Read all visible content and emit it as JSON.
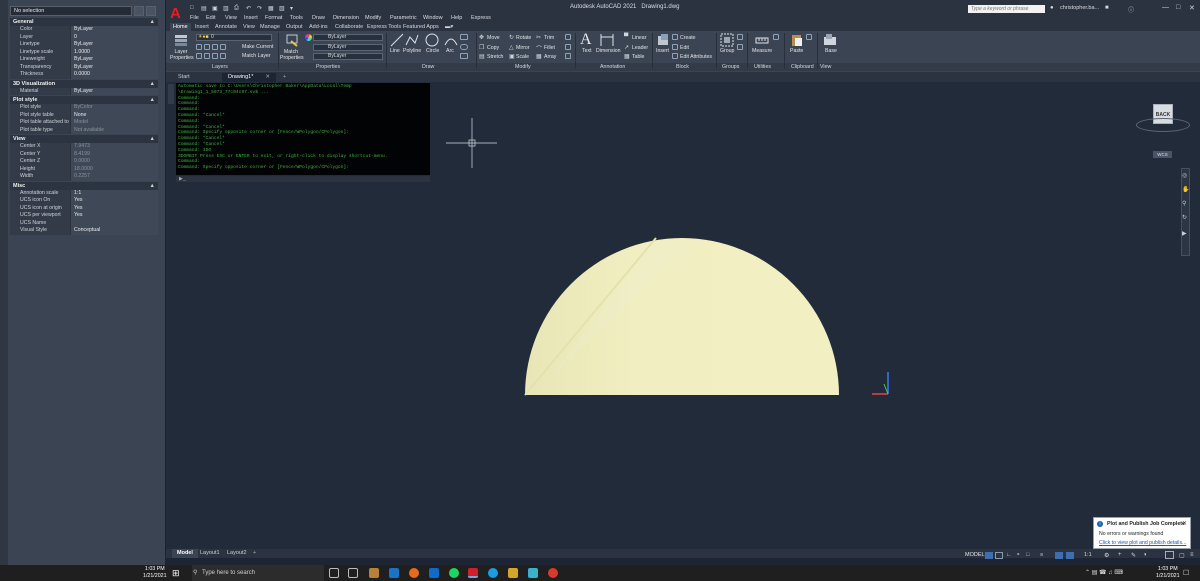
{
  "properties": {
    "selection": "No selection",
    "sections": [
      {
        "title": "General",
        "rows": [
          {
            "k": "Color",
            "v": "ByLayer"
          },
          {
            "k": "Layer",
            "v": "0"
          },
          {
            "k": "Linetype",
            "v": "ByLayer"
          },
          {
            "k": "Linetype scale",
            "v": "1.0000"
          },
          {
            "k": "Lineweight",
            "v": "ByLayer"
          },
          {
            "k": "Transparency",
            "v": "ByLayer"
          },
          {
            "k": "Thickness",
            "v": "0.0000"
          }
        ]
      },
      {
        "title": "3D Visualization",
        "rows": [
          {
            "k": "Material",
            "v": "ByLayer"
          }
        ]
      },
      {
        "title": "Plot style",
        "rows": [
          {
            "k": "Plot style",
            "v": "ByColor",
            "dim": true
          },
          {
            "k": "Plot style table",
            "v": "None"
          },
          {
            "k": "Plot table attached to",
            "v": "Model",
            "dim": true
          },
          {
            "k": "Plot table type",
            "v": "Not available",
            "dim": true
          }
        ]
      },
      {
        "title": "View",
        "rows": [
          {
            "k": "Center X",
            "v": "7.9473",
            "dim": true
          },
          {
            "k": "Center Y",
            "v": "8.4199",
            "dim": true
          },
          {
            "k": "Center Z",
            "v": "0.0000",
            "dim": true
          },
          {
            "k": "Height",
            "v": "18.0000",
            "dim": true
          },
          {
            "k": "Width",
            "v": "0.2257",
            "dim": true
          }
        ]
      },
      {
        "title": "Misc",
        "rows": [
          {
            "k": "Annotation scale",
            "v": "1:1"
          },
          {
            "k": "UCS icon On",
            "v": "Yes"
          },
          {
            "k": "UCS icon at origin",
            "v": "Yes"
          },
          {
            "k": "UCS per viewport",
            "v": "Yes"
          },
          {
            "k": "UCS Name",
            "v": ""
          },
          {
            "k": "Visual Style",
            "v": "Conceptual"
          }
        ]
      }
    ]
  },
  "title": {
    "app": "Autodesk AutoCAD 2021",
    "file": "Drawing1.dwg",
    "search_placeholder": "Type a keyword or phrase",
    "user": "christopher.ba..."
  },
  "menu": [
    "File",
    "Edit",
    "View",
    "Insert",
    "Format",
    "Tools",
    "Draw",
    "Dimension",
    "Modify",
    "Parametric",
    "Window",
    "Help",
    "Express"
  ],
  "ribbon_tabs": [
    "Home",
    "Insert",
    "Annotate",
    "View",
    "Manage",
    "Output",
    "Add-ins",
    "Collaborate",
    "Express Tools",
    "Featured Apps"
  ],
  "ribbon": {
    "layer_properties": "Layer Properties",
    "layer_combo": "0",
    "make_current": "Make Current",
    "match_layer": "Match Layer",
    "match_properties": "Match Properties",
    "bylayer1": "ByLayer",
    "bylayer2": "ByLayer",
    "bylayer3": "ByLayer",
    "line": "Line",
    "polyline": "Polyline",
    "circle": "Circle",
    "arc": "Arc",
    "move": "Move",
    "rotate": "Rotate",
    "trim": "Trim",
    "copy": "Copy",
    "mirror": "Mirror",
    "fillet": "Fillet",
    "stretch": "Stretch",
    "scale": "Scale",
    "array": "Array",
    "text": "Text",
    "dimension": "Dimension",
    "linear": "Linear",
    "leader": "Leader",
    "table": "Table",
    "insert": "Insert",
    "create": "Create",
    "edit": "Edit",
    "edit_attributes": "Edit Attributes",
    "group": "Group",
    "measure": "Measure",
    "paste": "Paste",
    "base": "Base",
    "panels": [
      "Layers",
      "Properties",
      "Draw",
      "Modify",
      "Annotation",
      "Block",
      "Groups",
      "Utilities",
      "Clipboard",
      "View"
    ]
  },
  "file_tabs": [
    "Start",
    "Drawing1*"
  ],
  "command_history": [
    "Automatic save to C:\\Users\\Christopher Baker\\AppData\\Local\\Temp",
    "\\Drawing1_1_5073_77c04c97.sv$ ...",
    "Command:",
    "Command:",
    "Command:",
    "Command: *Cancel*",
    "Command:",
    "Command: *Cancel*",
    "Command: Specify opposite corner or [Fence/WPolygon/CPolygon]:",
    "Command: *Cancel*",
    "Command: *Cancel*",
    "Command: 3DO",
    "3DORBIT Press ESC or ENTER to exit, or right-click to display shortcut-menu.",
    "Command:",
    "Command: Specify opposite corner or [Fence/WPolygon/CPolygon]:"
  ],
  "viewcube": {
    "back": "BACK",
    "wcs": "WCS"
  },
  "layout_tabs": [
    "Model",
    "Layout1",
    "Layout2"
  ],
  "status": {
    "model": "MODEL",
    "scale": "1:1"
  },
  "notification": {
    "title": "Plot and Publish Job Complete",
    "body": "No errors or warnings found",
    "link": "Click to view plot and publish details..."
  },
  "taskbar": {
    "search_placeholder": "Type here to search",
    "time": "1:03 PM",
    "date": "1/21/2021"
  },
  "colors": {
    "shape_fill": "#f2f0c2",
    "shape_shade": "#e6e4b0",
    "canvas": "#212b3a",
    "accent": "#e01e26"
  }
}
